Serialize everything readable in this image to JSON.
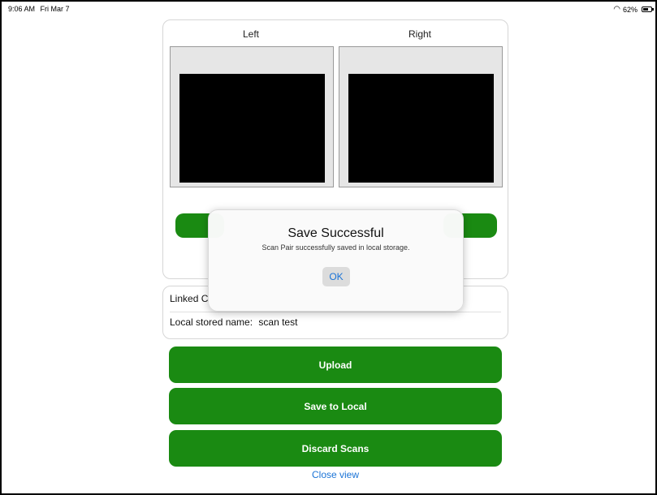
{
  "status_bar": {
    "time": "9:06 AM",
    "date": "Fri Mar 7",
    "battery": "62%",
    "icons": [
      "wifi-icon",
      "battery-icon"
    ]
  },
  "scan_card": {
    "left_label": "Left",
    "right_label": "Right"
  },
  "info": {
    "linked_label": "Linked C",
    "local_name_label": "Local stored name:",
    "local_name_value": "scan test"
  },
  "actions": {
    "upload": "Upload",
    "save_local": "Save to Local",
    "discard": "Discard Scans",
    "close": "Close view"
  },
  "alert": {
    "title": "Save Successful",
    "message": "Scan Pair successfully saved in local storage.",
    "ok": "OK"
  },
  "colors": {
    "accent_green": "#1a8a12",
    "link_blue": "#1a73d6"
  }
}
